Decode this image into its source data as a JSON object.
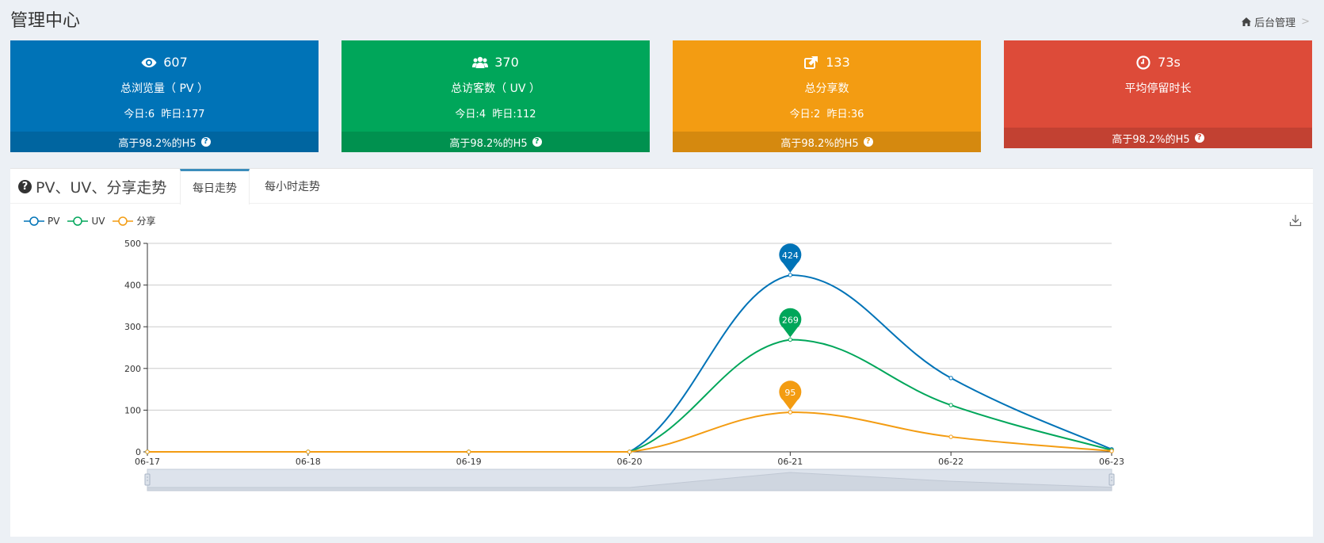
{
  "header": {
    "title": "管理中心",
    "breadcrumb": "后台管理"
  },
  "stats": [
    {
      "value": "607",
      "label": "总浏览量（ PV ）",
      "today_label": "今日:",
      "today": "6",
      "yesterday_label": "昨日:",
      "yesterday": "177",
      "footer": "高于98.2%的H5",
      "color": "#0073b7",
      "icon": "eye-icon"
    },
    {
      "value": "370",
      "label": "总访客数（ UV ）",
      "today_label": "今日:",
      "today": "4",
      "yesterday_label": "昨日:",
      "yesterday": "112",
      "footer": "高于98.2%的H5",
      "color": "#00a65a",
      "icon": "users-icon"
    },
    {
      "value": "133",
      "label": "总分享数",
      "today_label": "今日:",
      "today": "2",
      "yesterday_label": "昨日:",
      "yesterday": "36",
      "footer": "高于98.2%的H5",
      "color": "#f39c12",
      "icon": "share-icon"
    },
    {
      "value": "73s",
      "label": "平均停留时长",
      "footer": "高于98.2%的H5",
      "color": "#dd4b39",
      "icon": "clock-icon"
    }
  ],
  "panel": {
    "title": "PV、UV、分享走势",
    "tabs": [
      "每日走势",
      "每小时走势"
    ]
  },
  "chart_data": {
    "type": "line",
    "x": [
      "06-17",
      "06-18",
      "06-19",
      "06-20",
      "06-21",
      "06-22",
      "06-23"
    ],
    "ylim": [
      0,
      500
    ],
    "yticks": [
      0,
      100,
      200,
      300,
      400,
      500
    ],
    "series": [
      {
        "name": "PV",
        "color": "#0073b7",
        "values": [
          0,
          0,
          0,
          0,
          424,
          177,
          6
        ],
        "max_label": "424"
      },
      {
        "name": "UV",
        "color": "#00a65a",
        "values": [
          0,
          0,
          0,
          0,
          269,
          112,
          4
        ],
        "max_label": "269"
      },
      {
        "name": "分享",
        "color": "#f39c12",
        "values": [
          0,
          0,
          0,
          0,
          95,
          36,
          2
        ],
        "max_label": "95"
      }
    ],
    "legend_position": "top-left",
    "grid": true,
    "data_zoom": true
  }
}
